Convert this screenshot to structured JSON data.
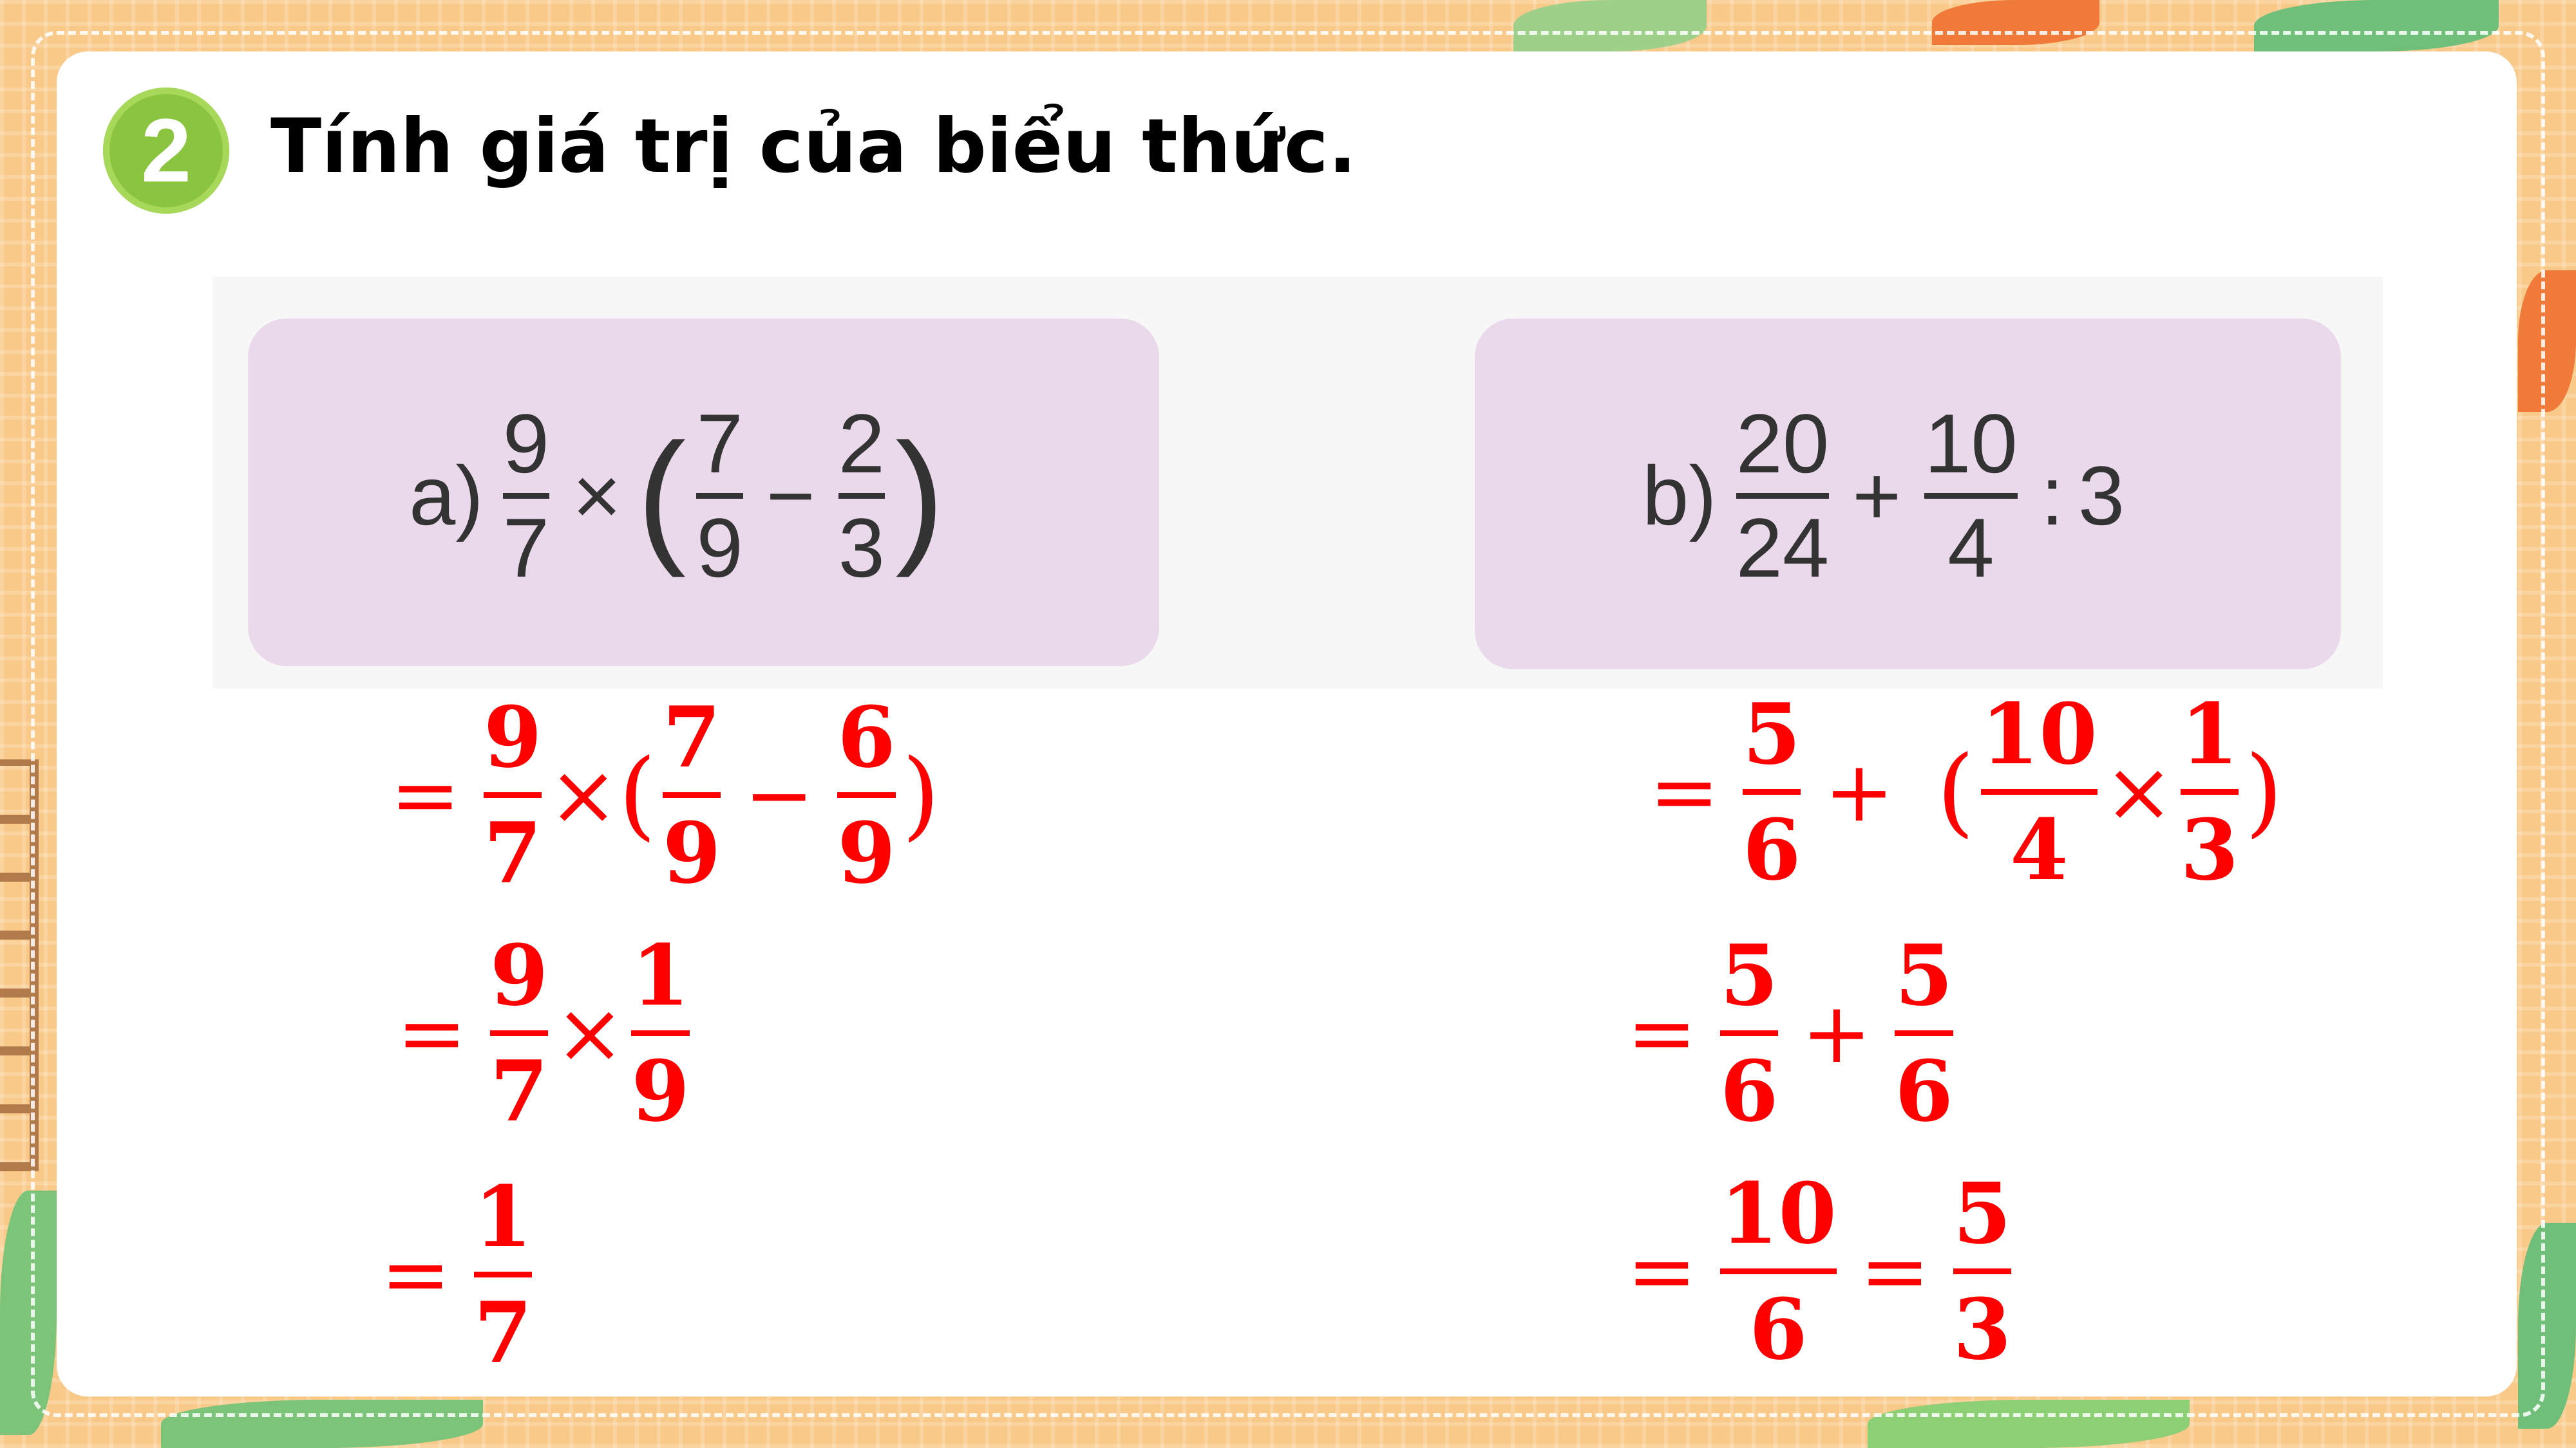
{
  "exercise": {
    "number": "2",
    "title": "Tính giá trị của biểu thức."
  },
  "problem_a": {
    "label": "a)",
    "f1": {
      "num": "9",
      "den": "7"
    },
    "times": "×",
    "open_paren": "(",
    "f2": {
      "num": "7",
      "den": "9"
    },
    "minus": "−",
    "f3": {
      "num": "2",
      "den": "3"
    },
    "close_paren": ")"
  },
  "problem_b": {
    "label": "b)",
    "f1": {
      "num": "20",
      "den": "24"
    },
    "plus": "+",
    "f2": {
      "num": "10",
      "den": "4"
    },
    "divide": ":",
    "divisor": "3"
  },
  "solution_a": {
    "step1": {
      "eq": "=",
      "f1": {
        "num": "9",
        "den": "7"
      },
      "times": "×",
      "open": "(",
      "f2": {
        "num": "7",
        "den": "9"
      },
      "minus": "−",
      "f3": {
        "num": "6",
        "den": "9"
      },
      "close": ")"
    },
    "step2": {
      "eq": "=",
      "f1": {
        "num": "9",
        "den": "7"
      },
      "times": "×",
      "f2": {
        "num": "1",
        "den": "9"
      }
    },
    "step3": {
      "eq": "=",
      "f1": {
        "num": "1",
        "den": "7"
      }
    }
  },
  "solution_b": {
    "step1": {
      "eq": "=",
      "f1": {
        "num": "5",
        "den": "6"
      },
      "plus": "+",
      "open": "(",
      "f2": {
        "num": "10",
        "den": "4"
      },
      "times": "×",
      "f3": {
        "num": "1",
        "den": "3"
      },
      "close": ")"
    },
    "step2": {
      "eq": "=",
      "f1": {
        "num": "5",
        "den": "6"
      },
      "plus": "+",
      "f2": {
        "num": "5",
        "den": "6"
      }
    },
    "step3": {
      "eq": "=",
      "f1": {
        "num": "10",
        "den": "6"
      },
      "eq2": "=",
      "f2": {
        "num": "5",
        "den": "3"
      }
    }
  },
  "colors": {
    "answer_red": "#ff0000",
    "badge_green": "#8bc53f",
    "panel_pink": "#ead9eb",
    "frame_orange": "#f9c98a"
  }
}
